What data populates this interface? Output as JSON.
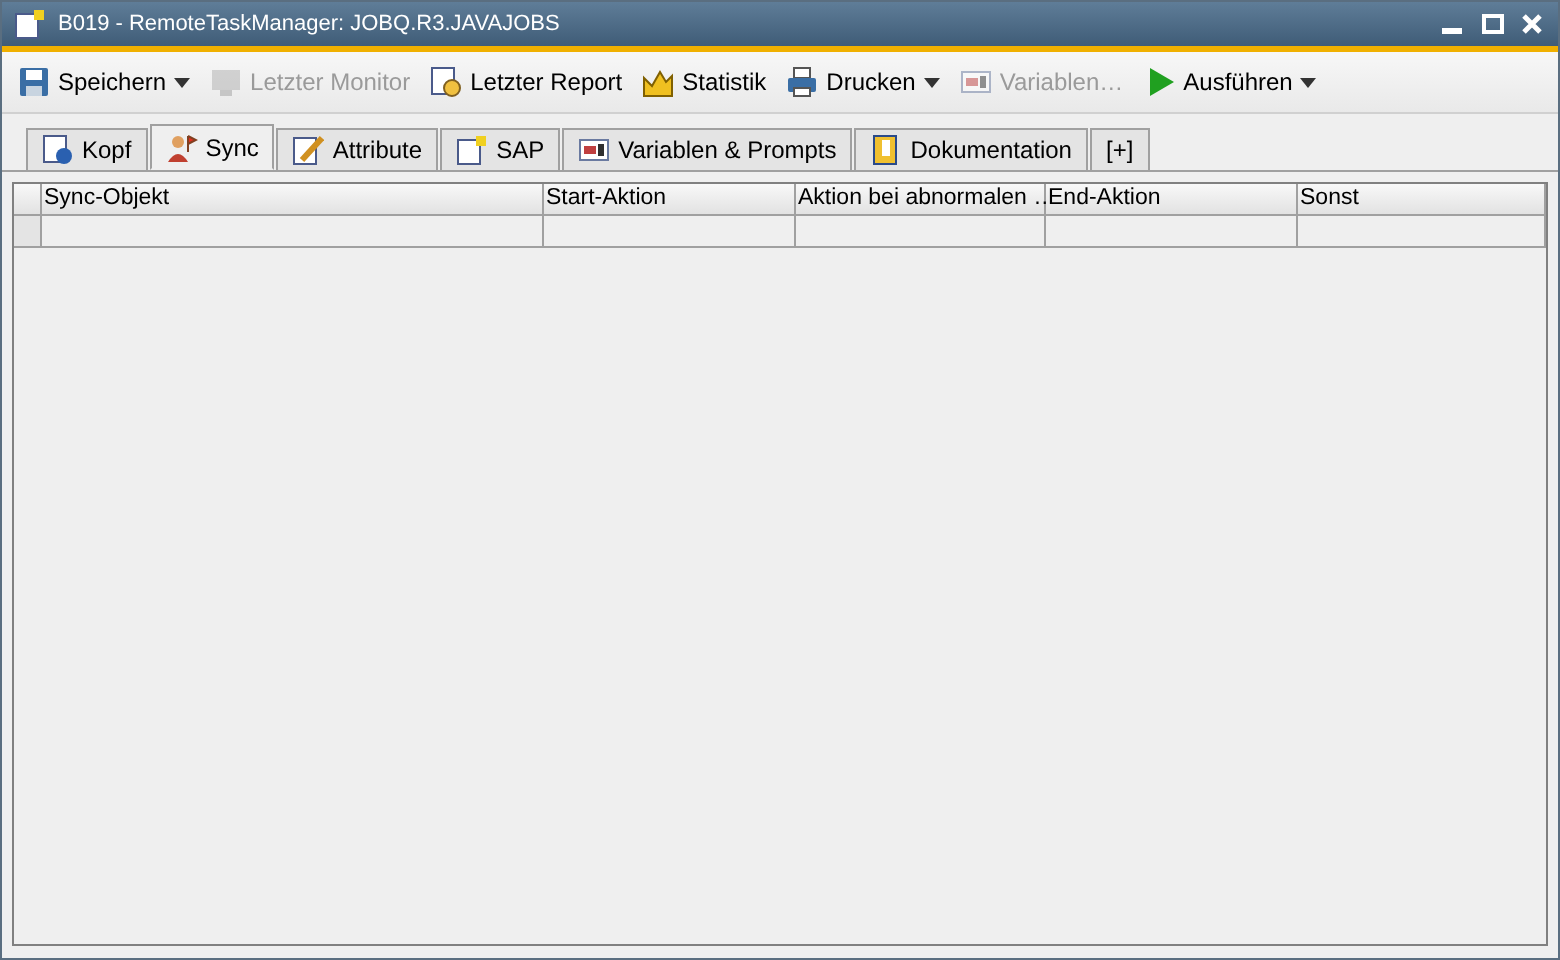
{
  "window": {
    "title": "B019 - RemoteTaskManager: JOBQ.R3.JAVAJOBS"
  },
  "toolbar": [
    {
      "label": "Speichern",
      "disabled": false,
      "dropdown": true
    },
    {
      "label": "Letzter Monitor",
      "disabled": true,
      "dropdown": false
    },
    {
      "label": "Letzter Report",
      "disabled": false,
      "dropdown": false
    },
    {
      "label": "Statistik",
      "disabled": false,
      "dropdown": false
    },
    {
      "label": "Drucken",
      "disabled": false,
      "dropdown": true
    },
    {
      "label": "Variablen…",
      "disabled": true,
      "dropdown": false
    },
    {
      "label": "Ausführen",
      "disabled": false,
      "dropdown": true
    }
  ],
  "tabs": [
    {
      "label": "Kopf",
      "selected": false
    },
    {
      "label": "Sync",
      "selected": true
    },
    {
      "label": "Attribute",
      "selected": false
    },
    {
      "label": "SAP",
      "selected": false
    },
    {
      "label": "Variablen & Prompts",
      "selected": false
    },
    {
      "label": "Dokumentation",
      "selected": false
    },
    {
      "label": "[+]",
      "selected": false
    }
  ],
  "table": {
    "columns": [
      "Sync-Objekt",
      "Start-Aktion",
      "Aktion bei abnormalen …",
      "End-Aktion",
      "Sonst"
    ]
  }
}
